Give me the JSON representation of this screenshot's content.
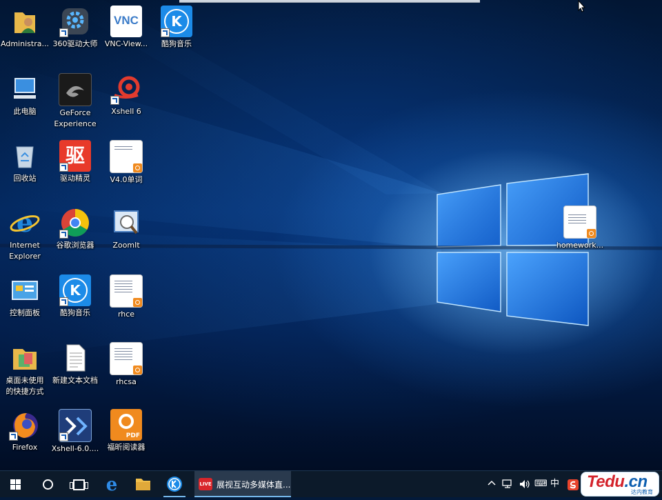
{
  "desktop": {
    "icons": {
      "administrator": "Administra...",
      "driver360": "360驱动大师",
      "vnc_viewer": "VNC-View...",
      "kugou_music_top": "酷狗音乐",
      "this_pc": "此电脑",
      "geforce_experience": "GeForce\nExperience",
      "xshell6": "Xshell 6",
      "recycle_bin": "回收站",
      "driver_genius": "驱动精灵",
      "v40_words": "V4.0单词",
      "internet_explorer": "Internet\nExplorer",
      "chrome": "谷歌浏览器",
      "zoomit": "ZoomIt",
      "control_panel": "控制面板",
      "kugou_music": "酷狗音乐",
      "rhce": "rhce",
      "unused_shortcuts": "桌面未使用\n的快捷方式",
      "new_text_doc": "新建文本文档",
      "rhcsa": "rhcsa",
      "firefox": "Firefox",
      "xshell_installer": "Xshell-6.0....",
      "foxit_reader": "福昕阅读器",
      "homework": "homework..."
    },
    "icon_glyph_text": {
      "vnc": "VNC",
      "kugou": "K",
      "driver_genius": "驱",
      "pdf": "PDF"
    }
  },
  "taskbar": {
    "running_window_title": "展视互动多媒体直...",
    "running_window_badge": "LIVE",
    "tray": {
      "chevron": "^",
      "ime": "中",
      "keyboard": "⌨"
    }
  },
  "watermark": {
    "brand_red": "Tedu",
    "brand_blue": ".cn",
    "subtitle": "达内教育"
  },
  "colors": {
    "taskbar": "#0c1a2a",
    "accent": "#76b9ed",
    "wallpaper_glow": "#2a86e6"
  }
}
